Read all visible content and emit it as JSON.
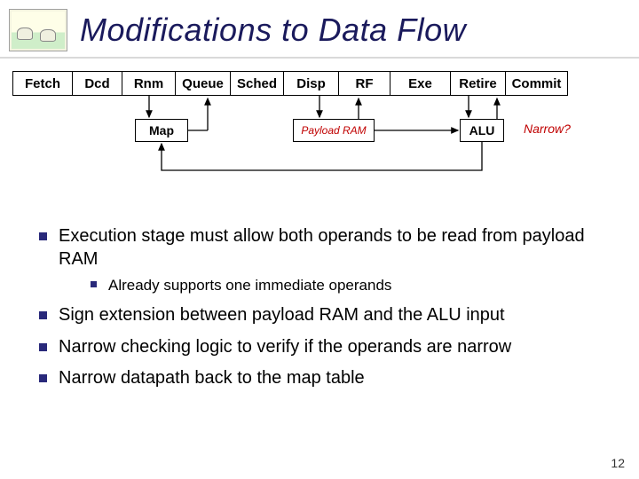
{
  "title": "Modifications to Data Flow",
  "page_number": "12",
  "pipeline": {
    "stages": [
      "Fetch",
      "Dcd",
      "Rnm",
      "Queue",
      "Sched",
      "Disp",
      "RF",
      "Exe",
      "Retire",
      "Commit"
    ],
    "sub": {
      "map": "Map",
      "payload_ram": "Payload RAM",
      "alu": "ALU",
      "narrow": "Narrow?"
    }
  },
  "bullets": {
    "b1": "Execution stage must allow both operands to be read from payload RAM",
    "b1a": "Already supports one immediate operands",
    "b2": "Sign extension between payload RAM and the ALU input",
    "b3": "Narrow checking logic to verify if the operands are narrow",
    "b4": "Narrow datapath back to the map table"
  }
}
